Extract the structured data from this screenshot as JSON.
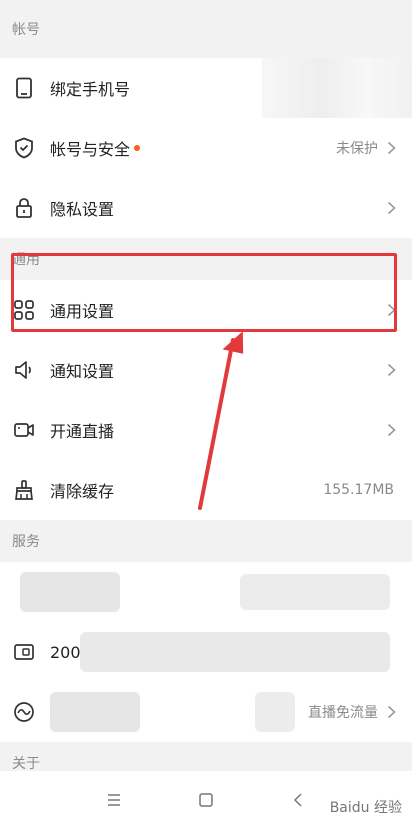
{
  "sections": {
    "account": "帐号",
    "general": "通用",
    "services": "服务",
    "about": "关于"
  },
  "rows": {
    "bind_phone": {
      "label": "绑定手机号"
    },
    "account_security": {
      "label": "帐号与安全",
      "value": "未保护"
    },
    "privacy": {
      "label": "隐私设置"
    },
    "general_settings": {
      "label": "通用设置"
    },
    "notification": {
      "label": "通知设置"
    },
    "live": {
      "label": "开通直播"
    },
    "cache": {
      "label": "清除缓存",
      "value": "155.17MB"
    },
    "service_1": {
      "label": "200"
    },
    "service_2": {
      "value": "直播免流量"
    }
  },
  "icons": {
    "phone": "phone-icon",
    "shield": "shield-icon",
    "lock": "lock-icon",
    "grid": "grid-icon",
    "speaker": "speaker-icon",
    "camera": "video-camera-icon",
    "broom": "broom-icon",
    "card": "card-icon",
    "wave": "wave-icon"
  },
  "colors": {
    "accent": "#e23a3a",
    "dot": "#ff5a1f"
  },
  "watermark": "Baidu 经验"
}
